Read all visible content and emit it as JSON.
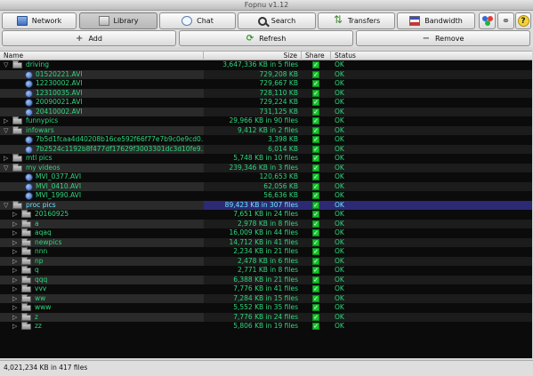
{
  "window": {
    "title": "Fopnu v1.12"
  },
  "toolbar": {
    "tabs": [
      {
        "label": "Network",
        "icon": "network-icon"
      },
      {
        "label": "Library",
        "icon": "library-icon",
        "active": true
      },
      {
        "label": "Chat",
        "icon": "chat-icon"
      },
      {
        "label": "Search",
        "icon": "search-icon"
      },
      {
        "label": "Transfers",
        "icon": "transfers-icon"
      },
      {
        "label": "Bandwidth",
        "icon": "bandwidth-icon"
      }
    ],
    "extra_icons": [
      "color-dots-icon",
      "link-icon",
      "help-icon"
    ]
  },
  "actions": {
    "add": "Add",
    "refresh": "Refresh",
    "remove": "Remove"
  },
  "columns": {
    "name": "Name",
    "size": "Size",
    "share": "Share",
    "status": "Status"
  },
  "rows": [
    {
      "name": "driving",
      "size": "3,647,336 KB in 5 files",
      "status": "OK",
      "type": "folder",
      "level": 0,
      "expanded": true
    },
    {
      "name": "01520221.AVI",
      "size": "729,208 KB",
      "status": "OK",
      "type": "video",
      "level": 1
    },
    {
      "name": "12230002.AVI",
      "size": "729,667 KB",
      "status": "OK",
      "type": "video",
      "level": 1
    },
    {
      "name": "12310035.AVI",
      "size": "728,110 KB",
      "status": "OK",
      "type": "video",
      "level": 1
    },
    {
      "name": "20090021.AVI",
      "size": "729,224 KB",
      "status": "OK",
      "type": "video",
      "level": 1
    },
    {
      "name": "20410002.AVI",
      "size": "731,125 KB",
      "status": "OK",
      "type": "video",
      "level": 1
    },
    {
      "name": "funnypics",
      "size": "29,966 KB in 90 files",
      "status": "OK",
      "type": "folder",
      "level": 0,
      "expanded": false
    },
    {
      "name": "infowars",
      "size": "9,412 KB in 2 files",
      "status": "OK",
      "type": "folder",
      "level": 0,
      "expanded": true
    },
    {
      "name": "7b5d1fcaa4d40208b16ce592f66f77e7b9c0e9cd0...",
      "size": "3,398 KB",
      "status": "OK",
      "type": "video",
      "level": 1
    },
    {
      "name": "7b2524c1192b8f477df17629f3003301dc3d10fe9...",
      "size": "6,014 KB",
      "status": "OK",
      "type": "video",
      "level": 1
    },
    {
      "name": "mtl pics",
      "size": "5,748 KB in 10 files",
      "status": "OK",
      "type": "folder",
      "level": 0,
      "expanded": false
    },
    {
      "name": "my videos",
      "size": "239,346 KB in 3 files",
      "status": "OK",
      "type": "folder",
      "level": 0,
      "expanded": true
    },
    {
      "name": "MVI_0377.AVI",
      "size": "120,653 KB",
      "status": "OK",
      "type": "video",
      "level": 1
    },
    {
      "name": "MVI_0410.AVI",
      "size": "62,056 KB",
      "status": "OK",
      "type": "video",
      "level": 1
    },
    {
      "name": "MVI_1990.AVI",
      "size": "56,636 KB",
      "status": "OK",
      "type": "video",
      "level": 1
    },
    {
      "name": "proc pics",
      "size": "89,423 KB in 307 files",
      "status": "OK",
      "type": "folder",
      "level": 0,
      "expanded": true,
      "selected": true
    },
    {
      "name": "20160925",
      "size": "7,651 KB in 24 files",
      "status": "OK",
      "type": "folder",
      "level": 1,
      "expanded": false
    },
    {
      "name": "a",
      "size": "2,978 KB in 8 files",
      "status": "OK",
      "type": "folder",
      "level": 1,
      "expanded": false
    },
    {
      "name": "aqaq",
      "size": "16,009 KB in 44 files",
      "status": "OK",
      "type": "folder",
      "level": 1,
      "expanded": false
    },
    {
      "name": "newpics",
      "size": "14,712 KB in 41 files",
      "status": "OK",
      "type": "folder",
      "level": 1,
      "expanded": false
    },
    {
      "name": "nnn",
      "size": "2,234 KB in 21 files",
      "status": "OK",
      "type": "folder",
      "level": 1,
      "expanded": false
    },
    {
      "name": "np",
      "size": "2,478 KB in 6 files",
      "status": "OK",
      "type": "folder",
      "level": 1,
      "expanded": false
    },
    {
      "name": "q",
      "size": "2,771 KB in 8 files",
      "status": "OK",
      "type": "folder",
      "level": 1,
      "expanded": false
    },
    {
      "name": "qqq",
      "size": "6,388 KB in 21 files",
      "status": "OK",
      "type": "folder",
      "level": 1,
      "expanded": false
    },
    {
      "name": "vvv",
      "size": "7,776 KB in 41 files",
      "status": "OK",
      "type": "folder",
      "level": 1,
      "expanded": false
    },
    {
      "name": "ww",
      "size": "7,284 KB in 15 files",
      "status": "OK",
      "type": "folder",
      "level": 1,
      "expanded": false
    },
    {
      "name": "www",
      "size": "5,552 KB in 35 files",
      "status": "OK",
      "type": "folder",
      "level": 1,
      "expanded": false
    },
    {
      "name": "z",
      "size": "7,776 KB in 24 files",
      "status": "OK",
      "type": "folder",
      "level": 1,
      "expanded": false
    },
    {
      "name": "zz",
      "size": "5,806 KB in 19 files",
      "status": "OK",
      "type": "folder",
      "level": 1,
      "expanded": false
    }
  ],
  "status_bar": {
    "text": "4,021,234 KB in 417 files"
  },
  "colors": {
    "tree_bg": "#0b0b0b",
    "text_green": "#2fd67c",
    "selected_bg": "#2c2a74",
    "share_check": "#13c42a"
  }
}
